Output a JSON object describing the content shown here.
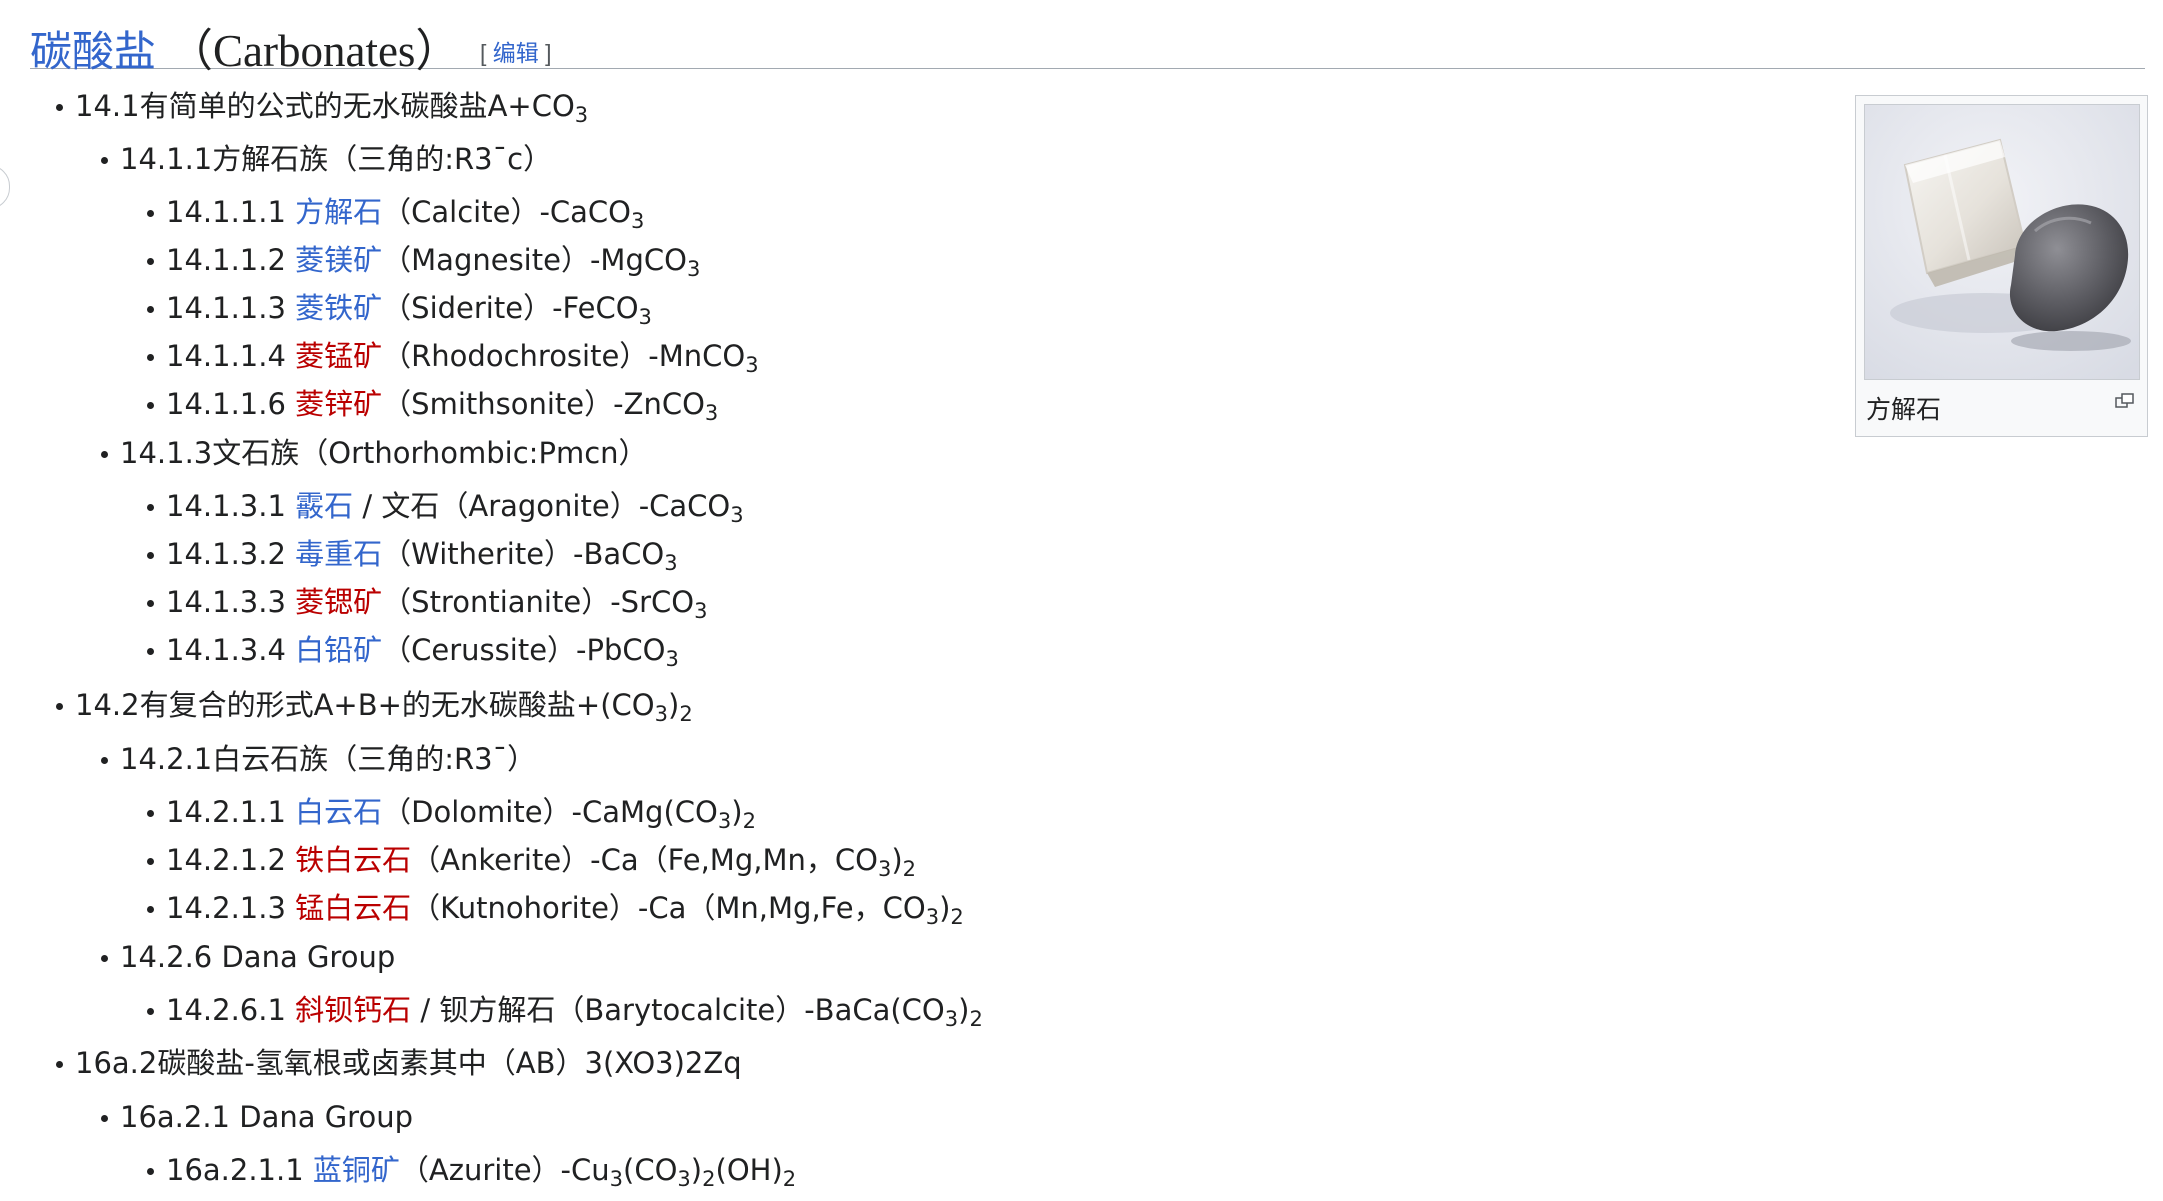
{
  "heading": {
    "zh": "碳酸盐",
    "en": "（Carbonates）",
    "edit_open": "[ ",
    "edit_label": "编辑",
    "edit_close": " ]"
  },
  "sections": [
    {
      "num": "14.1",
      "text": "有简单的公式的无水碳酸盐A+CO",
      "sub": "3"
    },
    {
      "num": "14.1.1",
      "text": "方解石族（三角的:R3¯c）"
    },
    {
      "num": "14.1.1.1",
      "link": "方解石",
      "link_type": "blue",
      "rest": "（Calcite）-CaCO",
      "sub": "3"
    },
    {
      "num": "14.1.1.2",
      "link": "菱镁矿",
      "link_type": "blue",
      "rest": "（Magnesite）-MgCO",
      "sub": "3"
    },
    {
      "num": "14.1.1.3",
      "link": "菱铁矿",
      "link_type": "blue",
      "rest": "（Siderite）-FeCO",
      "sub": "3"
    },
    {
      "num": "14.1.1.4",
      "link": "菱锰矿",
      "link_type": "red",
      "rest": "（Rhodochrosite）-MnCO",
      "sub": "3"
    },
    {
      "num": "14.1.1.6",
      "link": "菱锌矿",
      "link_type": "red",
      "rest": "（Smithsonite）-ZnCO",
      "sub": "3"
    },
    {
      "num": "14.1.3",
      "text": "文石族（Orthorhombic:Pmcn）"
    },
    {
      "num": "14.1.3.1",
      "link": "霰石",
      "link_type": "blue",
      "rest": " / 文石（Aragonite）-CaCO",
      "sub": "3"
    },
    {
      "num": "14.1.3.2",
      "link": "毒重石",
      "link_type": "blue",
      "rest": "（Witherite）-BaCO",
      "sub": "3"
    },
    {
      "num": "14.1.3.3",
      "link": "菱锶矿",
      "link_type": "red",
      "rest": "（Strontianite）-SrCO",
      "sub": "3"
    },
    {
      "num": "14.1.3.4",
      "link": "白铅矿",
      "link_type": "blue",
      "rest": "（Cerussite）-PbCO",
      "sub": "3"
    },
    {
      "num": "14.2",
      "text": "有复合的形式A+B+的无水碳酸盐+(CO",
      "sub": "3",
      "after": ")",
      "sub2": "2"
    },
    {
      "num": "14.2.1",
      "text": "白云石族（三角的:R3¯）"
    },
    {
      "num": "14.2.1.1",
      "link": "白云石",
      "link_type": "blue",
      "rest": "（Dolomite）-CaMg(CO",
      "sub": "3",
      "after": ")",
      "sub2": "2"
    },
    {
      "num": "14.2.1.2",
      "link": "铁白云石",
      "link_type": "red",
      "rest": "（Ankerite）-Ca（Fe,Mg,Mn，CO",
      "sub": "3",
      "after": ")",
      "sub2": "2"
    },
    {
      "num": "14.2.1.3",
      "link": "锰白云石",
      "link_type": "red",
      "rest": "（Kutnohorite）-Ca（Mn,Mg,Fe，CO",
      "sub": "3",
      "after": ")",
      "sub2": "2"
    },
    {
      "num": "14.2.6",
      "text": " Dana Group"
    },
    {
      "num": "14.2.6.1",
      "link": "斜钡钙石",
      "link_type": "red",
      "rest": " / 钡方解石（Barytocalcite）-BaCa(CO",
      "sub": "3",
      "after": ")",
      "sub2": "2"
    },
    {
      "num": "16a.2",
      "text": "碳酸盐-氢氧根或卤素其中（AB）3(XO3)2Zq"
    },
    {
      "num": "16a.2.1",
      "text": " Dana Group"
    },
    {
      "num": "16a.2.1.1",
      "link": "蓝铜矿",
      "link_type": "blue",
      "rest": "（Azurite）-Cu",
      "sub": "3",
      "after": "(CO",
      "sub2": "3",
      "after2": ")",
      "sub3": "2",
      "after3": "(OH)",
      "sub4": "2"
    }
  ],
  "infobox": {
    "caption": "方解石",
    "magnify_icon": "magnify-icon"
  },
  "colors": {
    "link_blue": "#3366cc",
    "link_red": "#ba0000",
    "text": "#202122",
    "border": "#a2a9b1"
  }
}
